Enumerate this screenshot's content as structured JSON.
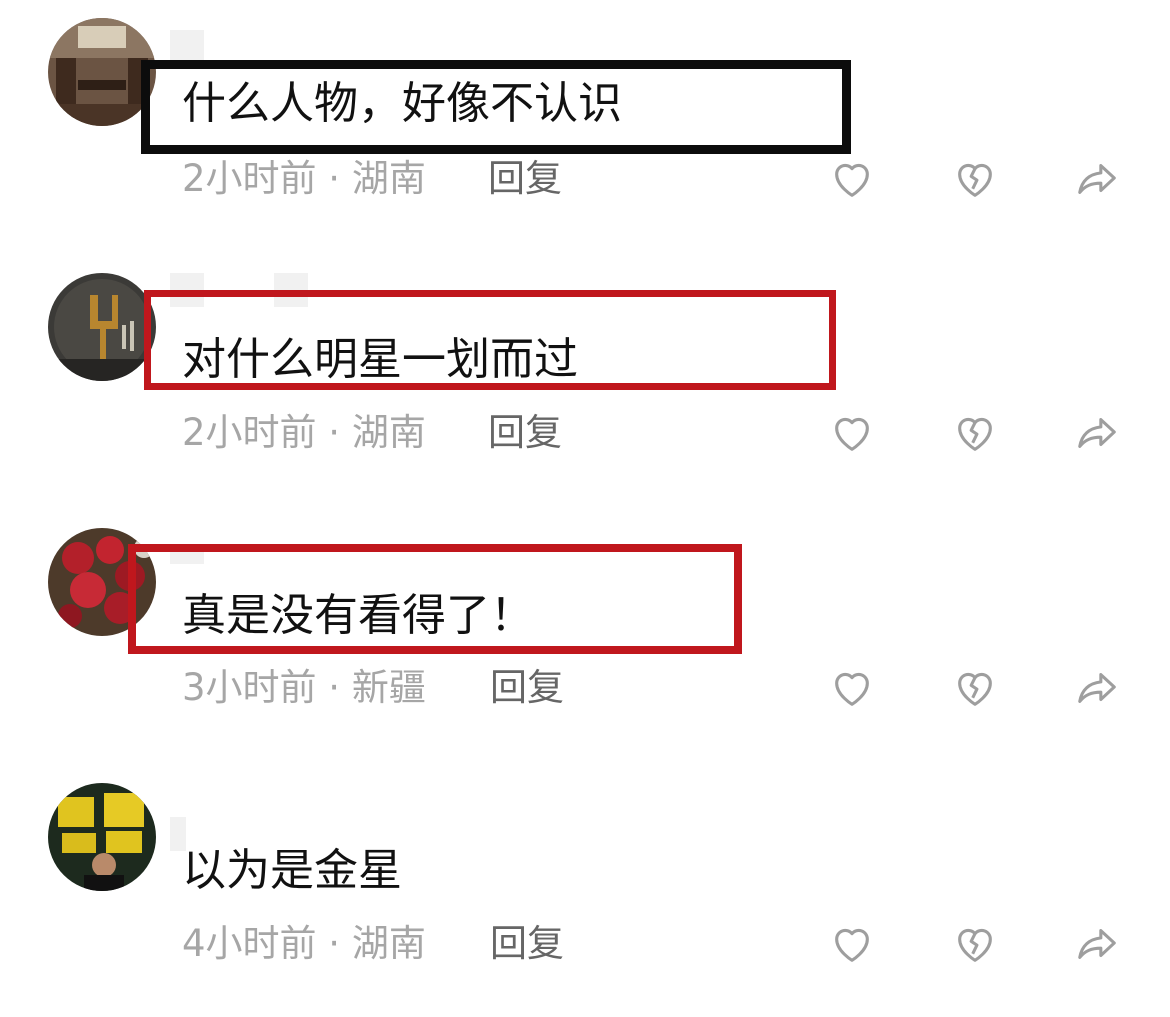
{
  "colors": {
    "highlight_black": "#0c0c0c",
    "highlight_red": "#c0171d",
    "meta_gray": "#a6a6a6",
    "reply_gray": "#666666",
    "icon_gray": "#9e9e9e"
  },
  "comments": [
    {
      "text": "什么人物，好像不认识",
      "time": "2小时前",
      "location": "湖南",
      "reply_label": "回复",
      "highlight": "black"
    },
    {
      "text": "对什么明星一划而过",
      "time": "2小时前",
      "location": "湖南",
      "reply_label": "回复",
      "highlight": "red"
    },
    {
      "text": "真是没有看得了！",
      "time": "3小时前",
      "location": "新疆",
      "reply_label": "回复",
      "highlight": "red"
    },
    {
      "text": "以为是金星",
      "time": "4小时前",
      "location": "湖南",
      "reply_label": "回复",
      "highlight": "none"
    }
  ],
  "separator": " · ",
  "icons": {
    "like": "heart-icon",
    "dislike": "broken-heart-icon",
    "share": "share-arrow-icon"
  }
}
